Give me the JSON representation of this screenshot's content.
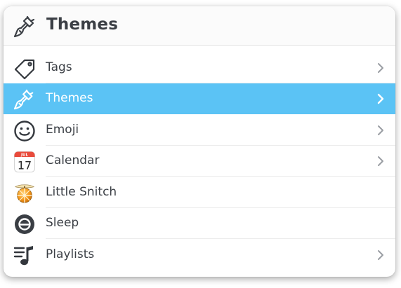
{
  "header": {
    "title": "Themes",
    "icon": "paintbrush-icon"
  },
  "items": [
    {
      "label": "Tags",
      "icon": "tag-icon",
      "has_chevron": true,
      "selected": false
    },
    {
      "label": "Themes",
      "icon": "paintbrush-icon",
      "has_chevron": true,
      "selected": true
    },
    {
      "label": "Emoji",
      "icon": "smiley-icon",
      "has_chevron": true,
      "selected": false
    },
    {
      "label": "Calendar",
      "icon": "calendar-icon",
      "has_chevron": true,
      "selected": false,
      "icon_month": "JUL",
      "icon_day": "17"
    },
    {
      "label": "Little Snitch",
      "icon": "little-snitch-icon",
      "has_chevron": false,
      "selected": false
    },
    {
      "label": "Sleep",
      "icon": "sleep-icon",
      "has_chevron": false,
      "selected": false
    },
    {
      "label": "Playlists",
      "icon": "playlist-icon",
      "has_chevron": true,
      "selected": false
    }
  ],
  "colors": {
    "selection": "#5bc3f5",
    "text": "#3c4046",
    "chevron": "#9a9ea3",
    "calendar_red": "#e94b3c"
  }
}
